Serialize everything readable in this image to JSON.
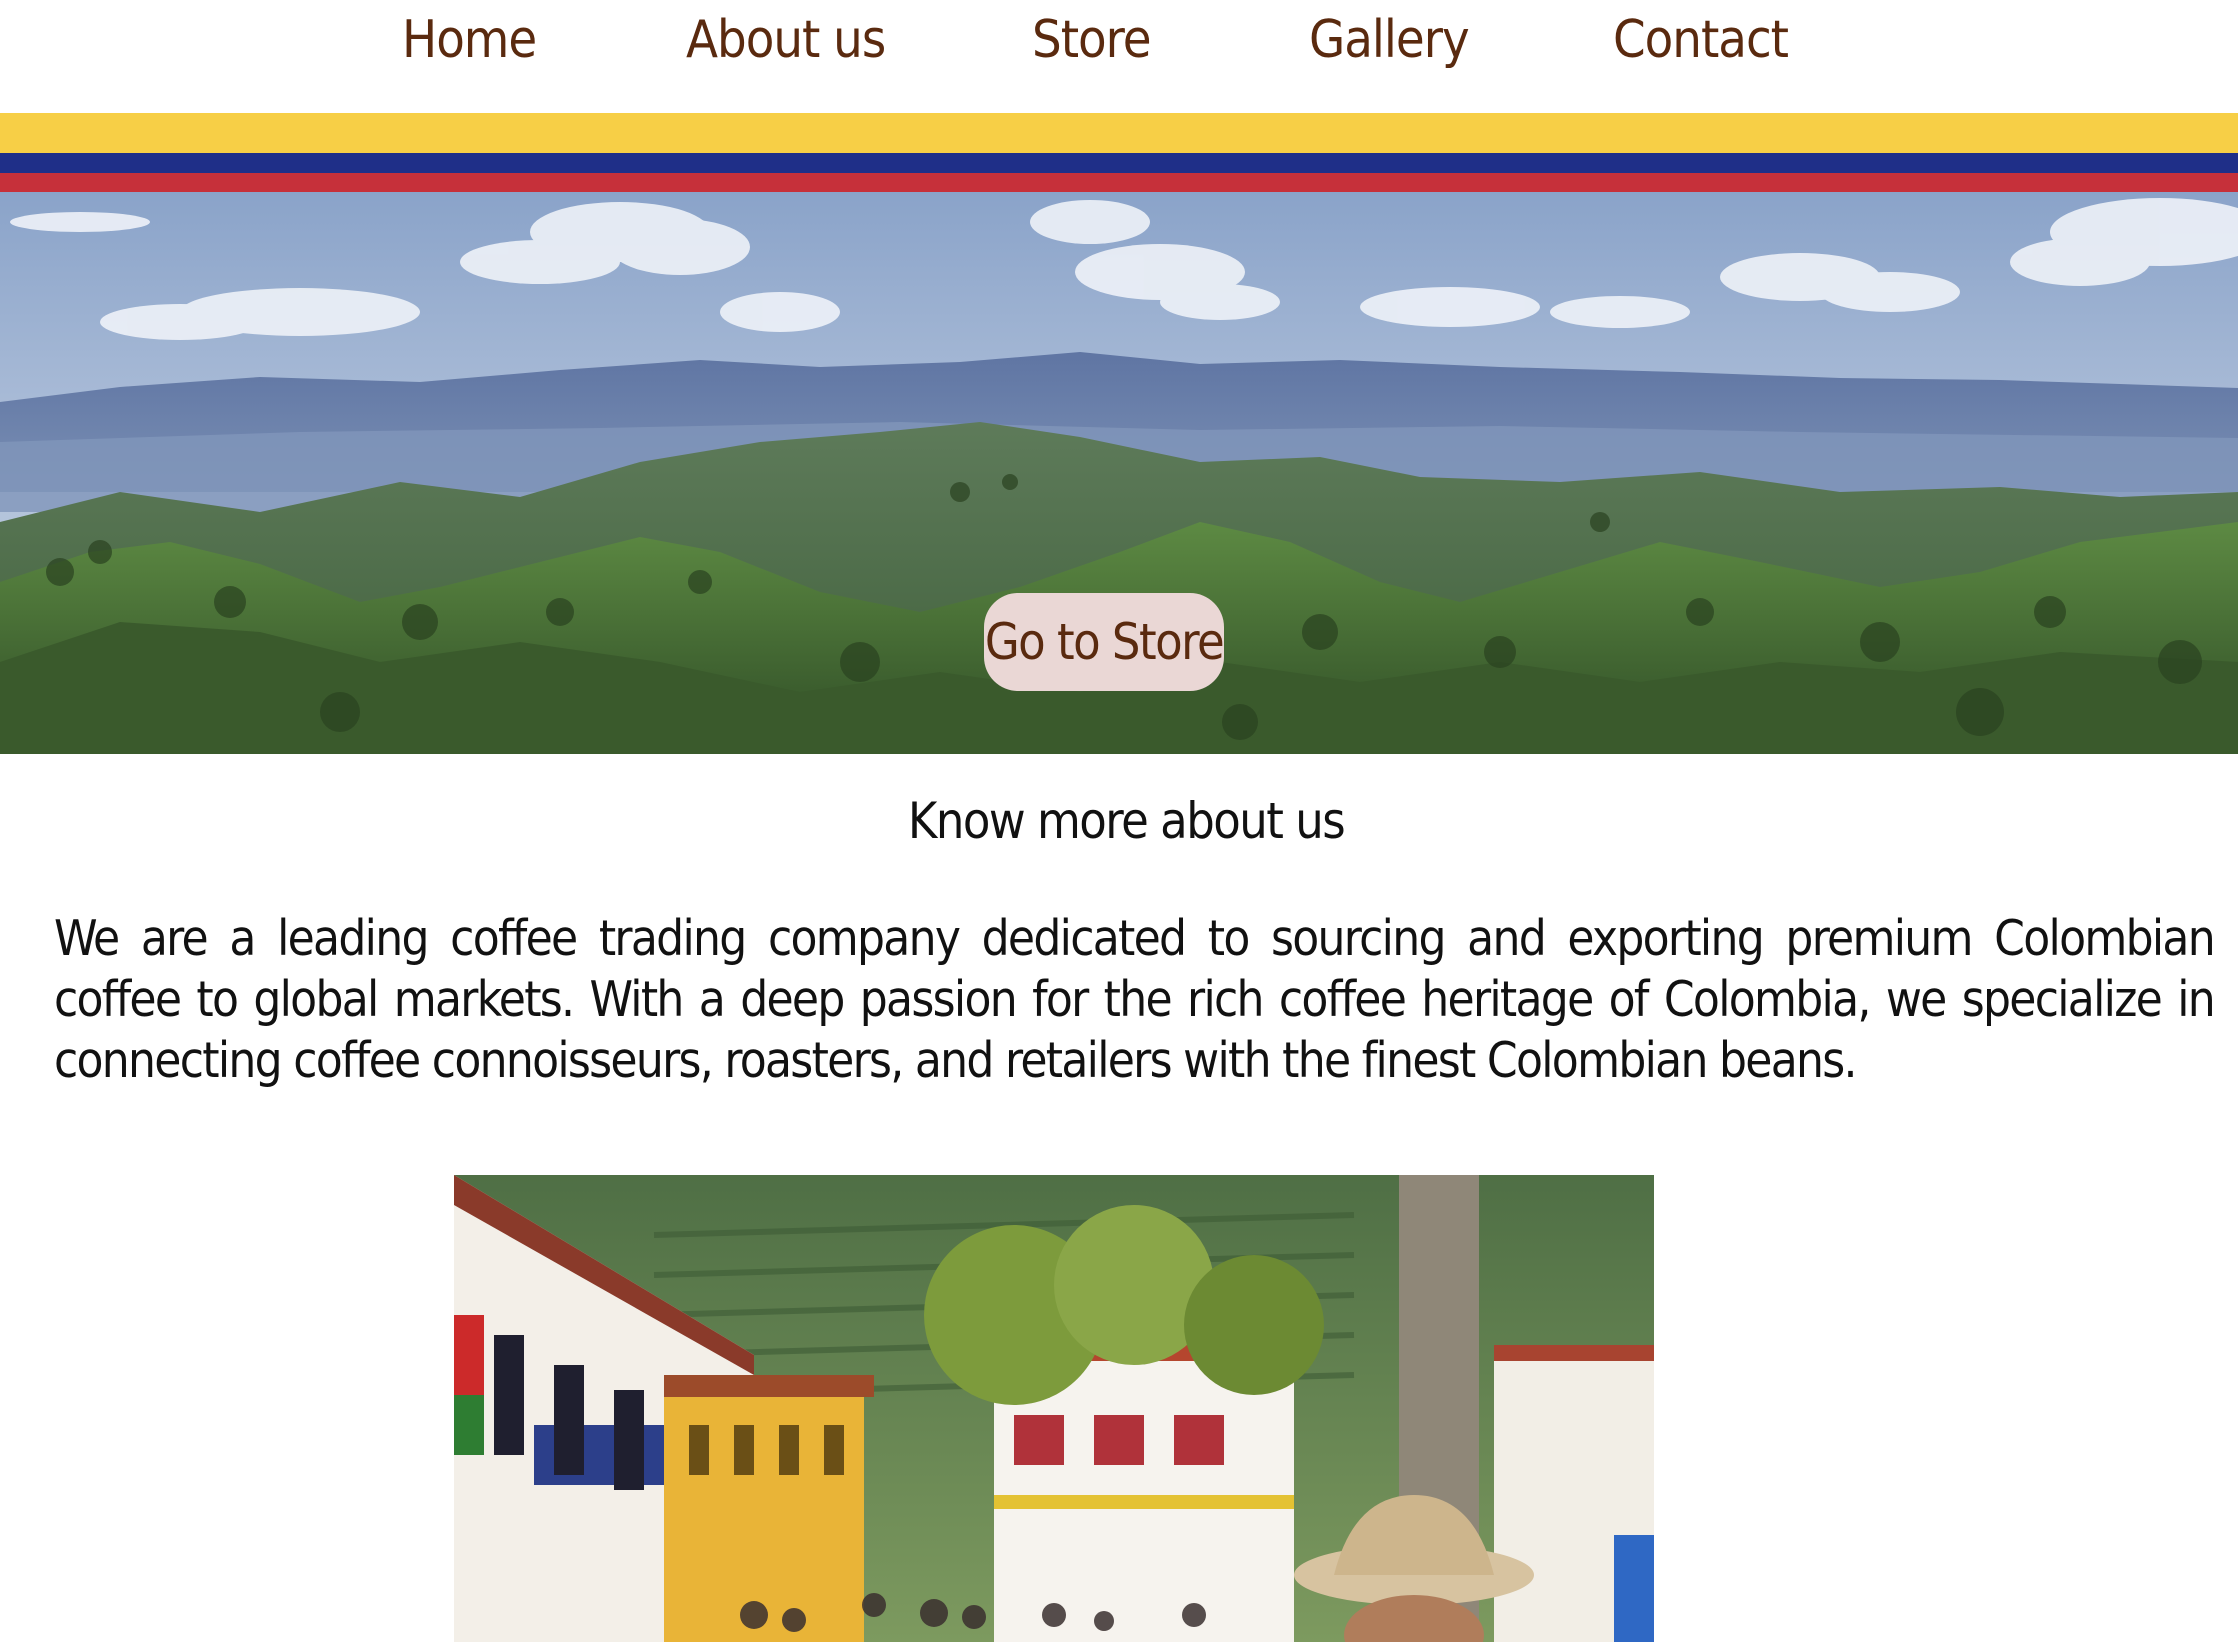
{
  "nav": {
    "items": [
      {
        "label": "Home"
      },
      {
        "label": "About us"
      },
      {
        "label": "Store"
      },
      {
        "label": "Gallery"
      },
      {
        "label": "Contact"
      }
    ]
  },
  "flag_colors": {
    "yellow": "#f7cf46",
    "blue": "#1f2f88",
    "red": "#c6303a"
  },
  "hero": {
    "button_label": "Go to Store"
  },
  "about": {
    "heading": "Know more about us",
    "body": "We are a leading coffee trading company dedicated to sourcing and exporting premium Colombian coffee to global markets. With a deep passion for the rich coffee heritage of Colombia, we specialize in connecting coffee connoisseurs, roasters, and retailers with the finest Colombian beans."
  },
  "accent_color": "#5a2a0f"
}
